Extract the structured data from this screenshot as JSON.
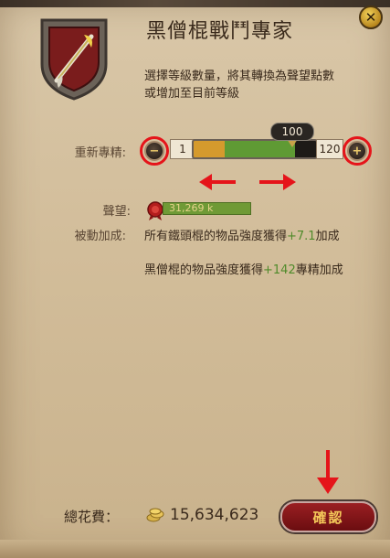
{
  "window": {
    "title": "黑僧棍戰鬥專家",
    "description_line1": "選擇等級數量，將其轉換為聲望點數",
    "description_line2": "或增加至目前等級"
  },
  "level_selector": {
    "label": "重新專精:",
    "min_value": "1",
    "max_value": "120",
    "selected_badge": "100",
    "minus_icon": "minus-icon",
    "plus_icon": "plus-icon",
    "selected_fraction": 0.83,
    "current_fraction": 0.25
  },
  "reputation": {
    "label": "聲望:",
    "value": "31,269 k",
    "icon": "wax-seal-icon"
  },
  "passive_bonus": {
    "label": "被動加成:",
    "line1_prefix": "所有鐵頭棍的物品強度獲得",
    "line1_value": "+7.1",
    "line1_suffix": "加成",
    "line2_prefix": "黑僧棍的物品強度獲得",
    "line2_value": "+142",
    "line2_suffix": "專精加成"
  },
  "footer": {
    "cost_label": "總花費：",
    "cost_value": "15,634,623",
    "coin_icon": "silver-coins-icon",
    "confirm_label": "確認"
  },
  "colors": {
    "panel": "#d5c29f",
    "annotation_red": "#e5141a",
    "slider_orange": "#d59a2d",
    "slider_green": "#5f9a34",
    "bonus_green": "#4f8a2a",
    "confirm_red": "#8a1519"
  }
}
